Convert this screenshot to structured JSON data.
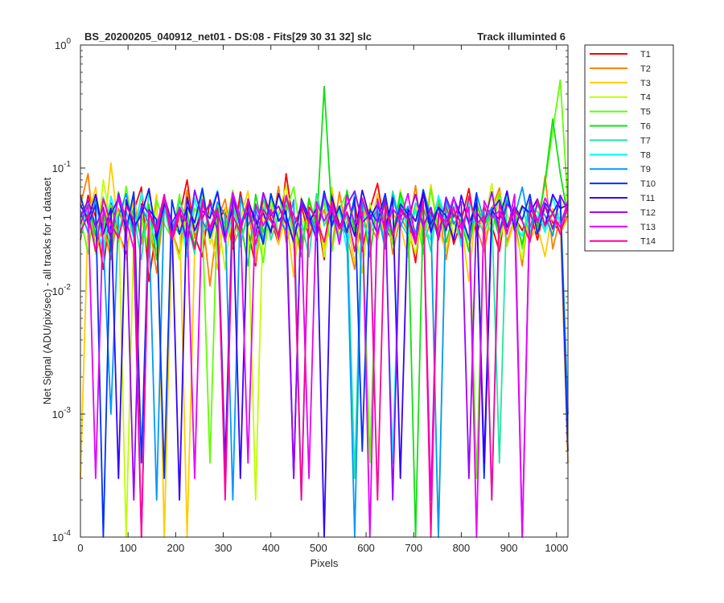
{
  "chart_data": {
    "type": "line",
    "title_left": "BS_20200205_040912_net01 - DS:08 - Fits[29  30  31  32]   slc",
    "title_right": "Track illuminted 6",
    "xlabel": "Pixels",
    "ylabel": "Net Signal (ADU/pix/sec) - all tracks for 1 dataset",
    "xlim": [
      0,
      1024
    ],
    "ylim": [
      0.0001,
      1
    ],
    "yscale": "log",
    "x_ticks": [
      0,
      100,
      200,
      300,
      400,
      500,
      600,
      700,
      800,
      900,
      1000
    ],
    "x_tick_labels": [
      "0",
      "100",
      "200",
      "300",
      "400",
      "500",
      "600",
      "700",
      "800",
      "900",
      "1000"
    ],
    "y_ticks": [
      0.0001,
      0.001,
      0.01,
      0.1,
      1
    ],
    "y_tick_bases": [
      "10",
      "10",
      "10",
      "10",
      "10"
    ],
    "y_tick_exponents": [
      "-4",
      "-3",
      "-2",
      "-1",
      "0"
    ],
    "grid": false,
    "legend_position": "outside-top-right",
    "x_start": 0,
    "x_step": 16,
    "series": [
      {
        "name": "T1",
        "color": "#ff0000",
        "values": [
          0.026,
          0.06,
          0.04,
          0.015,
          0.052,
          0.03,
          0.02,
          0.045,
          0.07,
          0.012,
          0.034,
          0.05,
          0.025,
          0.041,
          0.08,
          0.028,
          0.019,
          0.055,
          0.036,
          0.047,
          0.022,
          0.064,
          0.031,
          0.016,
          0.058,
          0.039,
          0.024,
          0.09,
          0.033,
          0.05,
          0.027,
          0.044,
          0.018,
          0.062,
          0.035,
          0.029,
          0.053,
          0.021,
          0.046,
          0.075,
          0.032,
          0.026,
          0.05,
          0.038,
          0.017,
          0.061,
          0.043,
          0.03,
          0.052,
          0.024,
          0.037,
          0.068,
          0.028,
          0.049,
          0.034,
          0.021,
          0.057,
          0.04,
          0.031,
          0.045,
          0.026,
          0.05,
          0.036,
          0.03,
          0.041
        ]
      },
      {
        "name": "T2",
        "color": "#ff7f00",
        "values": [
          0.05,
          0.09,
          0.02,
          0.035,
          0.018,
          0.047,
          0.028,
          0.061,
          0.024,
          0.039,
          0.014,
          0.052,
          0.031,
          0.02,
          0.066,
          0.027,
          0.043,
          0.011,
          0.038,
          0.056,
          0.023,
          0.033,
          0.049,
          0.017,
          0.042,
          0.029,
          0.071,
          0.025,
          0.036,
          0.019,
          0.054,
          0.032,
          0.046,
          0.022,
          0.064,
          0.028,
          0.015,
          0.048,
          0.035,
          0.026,
          0.059,
          0.02,
          0.041,
          0.03,
          0.072,
          0.024,
          0.037,
          0.051,
          0.018,
          0.044,
          0.027,
          0.058,
          0.033,
          0.021,
          0.046,
          0.069,
          0.025,
          0.039,
          0.016,
          0.053,
          0.03,
          0.086,
          0.022,
          0.04,
          0.0004
        ]
      },
      {
        "name": "T3",
        "color": "#ffcc00",
        "values": [
          0.0003,
          0.04,
          0.07,
          0.025,
          0.11,
          0.031,
          0.018,
          0.052,
          0.036,
          0.023,
          0.061,
          0.0001,
          0.029,
          0.044,
          0.0001,
          0.021,
          0.057,
          0.033,
          0.015,
          0.048,
          0.027,
          0.039,
          0.065,
          0.02,
          0.035,
          0.05,
          0.024,
          0.042,
          0.013,
          0.058,
          0.031,
          0.045,
          0.022,
          0.07,
          0.028,
          0.037,
          0.017,
          0.053,
          0.03,
          0.062,
          0.025,
          0.043,
          0.034,
          0.019,
          0.049,
          0.028,
          0.073,
          0.032,
          0.021,
          0.046,
          0.036,
          0.012,
          0.055,
          0.027,
          0.04,
          0.064,
          0.023,
          0.038,
          0.05,
          0.026,
          0.034,
          0.019,
          0.047,
          0.029,
          0.04
        ]
      },
      {
        "name": "T4",
        "color": "#bfff00",
        "values": [
          0.03,
          0.05,
          0.02,
          0.08,
          0.035,
          0.044,
          0.0001,
          0.028,
          0.061,
          0.038,
          0.021,
          0.053,
          0.03,
          0.018,
          0.047,
          0.034,
          0.065,
          0.024,
          0.041,
          0.015,
          0.056,
          0.029,
          0.037,
          0.0002,
          0.05,
          0.026,
          0.043,
          0.072,
          0.022,
          0.039,
          0.031,
          0.058,
          0.019,
          0.046,
          0.027,
          0.062,
          0.035,
          0.014,
          0.052,
          0.03,
          0.041,
          0.024,
          0.067,
          0.033,
          0.02,
          0.048,
          0.036,
          0.0001,
          0.057,
          0.028,
          0.04,
          0.023,
          0.051,
          0.034,
          0.075,
          0.026,
          0.042,
          0.031,
          0.018,
          0.054,
          0.037,
          0.05,
          0.03,
          0.045,
          0.06
        ]
      },
      {
        "name": "T5",
        "color": "#5fff00",
        "values": [
          0.04,
          0.02,
          0.06,
          0.033,
          0.05,
          0.025,
          0.071,
          0.03,
          0.043,
          0.019,
          0.055,
          0.035,
          0.027,
          0.061,
          0.022,
          0.047,
          0.038,
          0.0004,
          0.052,
          0.031,
          0.066,
          0.024,
          0.041,
          0.036,
          0.017,
          0.058,
          0.029,
          0.045,
          0.07,
          0.026,
          0.039,
          0.032,
          0.053,
          0.021,
          0.047,
          0.063,
          0.028,
          0.042,
          0.0004,
          0.035,
          0.05,
          0.024,
          0.059,
          0.033,
          0.046,
          0.02,
          0.068,
          0.03,
          0.044,
          0.037,
          0.025,
          0.054,
          0.0003,
          0.041,
          0.029,
          0.062,
          0.034,
          0.049,
          0.022,
          0.056,
          0.038,
          0.075,
          0.2,
          0.52,
          0.05
        ]
      },
      {
        "name": "T6",
        "color": "#10e010",
        "values": [
          0.035,
          0.055,
          0.028,
          0.042,
          0.021,
          0.064,
          0.032,
          0.047,
          0.026,
          0.051,
          0.018,
          0.058,
          0.037,
          0.029,
          0.044,
          0.023,
          0.069,
          0.031,
          0.048,
          0.025,
          0.053,
          0.039,
          0.016,
          0.061,
          0.03,
          0.045,
          0.027,
          0.05,
          0.036,
          0.022,
          0.057,
          0.033,
          0.46,
          0.042,
          0.026,
          0.066,
          0.031,
          0.049,
          0.019,
          0.054,
          0.036,
          0.028,
          0.063,
          0.04,
          0.0001,
          0.047,
          0.032,
          0.058,
          0.025,
          0.043,
          0.037,
          0.021,
          0.052,
          0.034,
          0.046,
          0.027,
          0.06,
          0.039,
          0.024,
          0.05,
          0.033,
          0.078,
          0.25,
          0.09,
          0.04
        ]
      },
      {
        "name": "T7",
        "color": "#20e6a0",
        "values": [
          0.03,
          0.045,
          0.022,
          0.058,
          0.036,
          0.027,
          0.05,
          0.041,
          0.018,
          0.063,
          0.032,
          0.048,
          0.025,
          0.054,
          0.038,
          0.02,
          0.067,
          0.029,
          0.044,
          0.035,
          0.052,
          0.023,
          0.046,
          0.031,
          0.06,
          0.026,
          0.041,
          0.055,
          0.03,
          0.037,
          0.019,
          0.062,
          0.034,
          0.048,
          0.027,
          0.043,
          0.0003,
          0.057,
          0.031,
          0.046,
          0.024,
          0.065,
          0.036,
          0.028,
          0.052,
          0.04,
          0.021,
          0.059,
          0.033,
          0.047,
          0.026,
          0.056,
          0.038,
          0.03,
          0.045,
          0.0004,
          0.061,
          0.035,
          0.049,
          0.029,
          0.053,
          0.032,
          0.043,
          0.037,
          0.05
        ]
      },
      {
        "name": "T8",
        "color": "#00ffff",
        "values": [
          0.028,
          0.05,
          0.036,
          0.021,
          0.059,
          0.032,
          0.045,
          0.027,
          0.063,
          0.038,
          0.024,
          0.052,
          0.034,
          0.046,
          0.019,
          0.057,
          0.03,
          0.043,
          0.066,
          0.026,
          0.04,
          0.035,
          0.054,
          0.022,
          0.048,
          0.031,
          0.061,
          0.037,
          0.025,
          0.05,
          0.044,
          0.029,
          0.058,
          0.033,
          0.047,
          0.021,
          0.064,
          0.036,
          0.028,
          0.053,
          0.04,
          0.0004,
          0.056,
          0.03,
          0.045,
          0.034,
          0.026,
          0.06,
          0.038,
          0.049,
          0.023,
          0.055,
          0.032,
          0.046,
          0.0002,
          0.041,
          0.062,
          0.035,
          0.028,
          0.051,
          0.044,
          0.03,
          0.058,
          0.036,
          0.047
        ]
      },
      {
        "name": "T9",
        "color": "#0099ff",
        "values": [
          0.045,
          0.03,
          0.055,
          0.025,
          0.001,
          0.04,
          0.062,
          0.028,
          0.049,
          0.035,
          0.0002,
          0.057,
          0.032,
          0.044,
          0.024,
          0.066,
          0.037,
          0.029,
          0.053,
          0.041,
          0.0002,
          0.058,
          0.034,
          0.047,
          0.026,
          0.061,
          0.039,
          0.031,
          0.055,
          0.0002,
          0.044,
          0.03,
          0.064,
          0.036,
          0.048,
          0.027,
          0.0001,
          0.052,
          0.038,
          0.045,
          0.022,
          0.06,
          0.033,
          0.049,
          0.029,
          0.067,
          0.04,
          0.0001,
          0.056,
          0.035,
          0.043,
          0.026,
          0.062,
          0.037,
          0.048,
          0.031,
          0.054,
          0.04,
          0.07,
          0.033,
          0.05,
          0.041,
          0.028,
          0.06,
          0.001
        ]
      },
      {
        "name": "T10",
        "color": "#0030ff",
        "values": [
          0.06,
          0.035,
          0.05,
          0.0001,
          0.042,
          0.057,
          0.031,
          0.064,
          0.0004,
          0.046,
          0.038,
          0.0003,
          0.055,
          0.029,
          0.049,
          0.036,
          0.068,
          0.027,
          0.044,
          0.0004,
          0.06,
          0.033,
          0.052,
          0.039,
          0.024,
          0.062,
          0.037,
          0.045,
          0.0003,
          0.056,
          0.041,
          0.026,
          0.065,
          0.034,
          0.049,
          0.03,
          0.058,
          0.0005,
          0.046,
          0.036,
          0.062,
          0.028,
          0.051,
          0.042,
          0.025,
          0.066,
          0.035,
          0.048,
          0.031,
          0.057,
          0.04,
          0.027,
          0.063,
          0.0003,
          0.045,
          0.055,
          0.033,
          0.049,
          0.038,
          0.061,
          0.029,
          0.052,
          0.043,
          0.056,
          0.0005
        ]
      },
      {
        "name": "T11",
        "color": "#3300ff",
        "values": [
          0.05,
          0.038,
          0.061,
          0.029,
          0.047,
          0.0003,
          0.055,
          0.033,
          0.042,
          0.068,
          0.026,
          0.051,
          0.037,
          0.0002,
          0.058,
          0.031,
          0.045,
          0.039,
          0.064,
          0.027,
          0.049,
          0.0003,
          0.056,
          0.035,
          0.043,
          0.03,
          0.062,
          0.041,
          0.025,
          0.053,
          0.036,
          0.047,
          0.0001,
          0.059,
          0.033,
          0.044,
          0.028,
          0.066,
          0.039,
          0.051,
          0.032,
          0.057,
          0.0003,
          0.046,
          0.037,
          0.063,
          0.03,
          0.048,
          0.041,
          0.026,
          0.06,
          0.035,
          0.052,
          0.0004,
          0.045,
          0.038,
          0.065,
          0.031,
          0.049,
          0.043,
          0.056,
          0.034,
          0.061,
          0.047,
          0.05
        ]
      },
      {
        "name": "T12",
        "color": "#9900ff",
        "values": [
          0.04,
          0.055,
          0.033,
          0.048,
          0.026,
          0.062,
          0.037,
          0.0002,
          0.051,
          0.043,
          0.03,
          0.059,
          0.036,
          0.046,
          0.024,
          0.066,
          0.039,
          0.052,
          0.031,
          0.0003,
          0.057,
          0.034,
          0.045,
          0.028,
          0.063,
          0.041,
          0.049,
          0.035,
          0.0003,
          0.054,
          0.038,
          0.027,
          0.06,
          0.044,
          0.032,
          0.05,
          0.065,
          0.036,
          0.042,
          0.029,
          0.056,
          0.0002,
          0.047,
          0.039,
          0.061,
          0.033,
          0.048,
          0.026,
          0.058,
          0.04,
          0.053,
          0.0003,
          0.044,
          0.035,
          0.064,
          0.03,
          0.051,
          0.042,
          0.0001,
          0.055,
          0.037,
          0.049,
          0.032,
          0.06,
          0.045
        ]
      },
      {
        "name": "T13",
        "color": "#e600ff",
        "values": [
          0.035,
          0.05,
          0.0003,
          0.045,
          0.03,
          0.057,
          0.038,
          0.022,
          0.0001,
          0.042,
          0.033,
          0.061,
          0.028,
          0.048,
          0.036,
          0.0003,
          0.055,
          0.031,
          0.044,
          0.025,
          0.063,
          0.039,
          0.0004,
          0.051,
          0.034,
          0.046,
          0.027,
          0.058,
          0.041,
          0.032,
          0.0003,
          0.053,
          0.037,
          0.049,
          0.024,
          0.06,
          0.035,
          0.044,
          0.0001,
          0.056,
          0.03,
          0.047,
          0.038,
          0.062,
          0.026,
          0.051,
          0.0002,
          0.043,
          0.036,
          0.058,
          0.032,
          0.048,
          0.0001,
          0.054,
          0.039,
          0.045,
          0.029,
          0.061,
          0.0001,
          0.05,
          0.036,
          0.057,
          0.042,
          0.033,
          0.055
        ]
      },
      {
        "name": "T14",
        "color": "#ff0099",
        "values": [
          0.03,
          0.042,
          0.021,
          0.056,
          0.035,
          0.027,
          0.049,
          0.038,
          0.0001,
          0.045,
          0.031,
          0.058,
          0.026,
          0.043,
          0.036,
          0.022,
          0.052,
          0.033,
          0.047,
          0.0002,
          0.041,
          0.03,
          0.055,
          0.024,
          0.046,
          0.037,
          0.029,
          0.06,
          0.034,
          0.0002,
          0.048,
          0.039,
          0.025,
          0.053,
          0.032,
          0.044,
          0.021,
          0.057,
          0.036,
          0.0002,
          0.05,
          0.028,
          0.045,
          0.038,
          0.024,
          0.054,
          0.0001,
          0.042,
          0.033,
          0.048,
          0.027,
          0.059,
          0.035,
          0.041,
          0.0002,
          0.052,
          0.03,
          0.046,
          0.037,
          0.025,
          0.055,
          0.034,
          0.043,
          0.029,
          0.05
        ]
      }
    ]
  }
}
